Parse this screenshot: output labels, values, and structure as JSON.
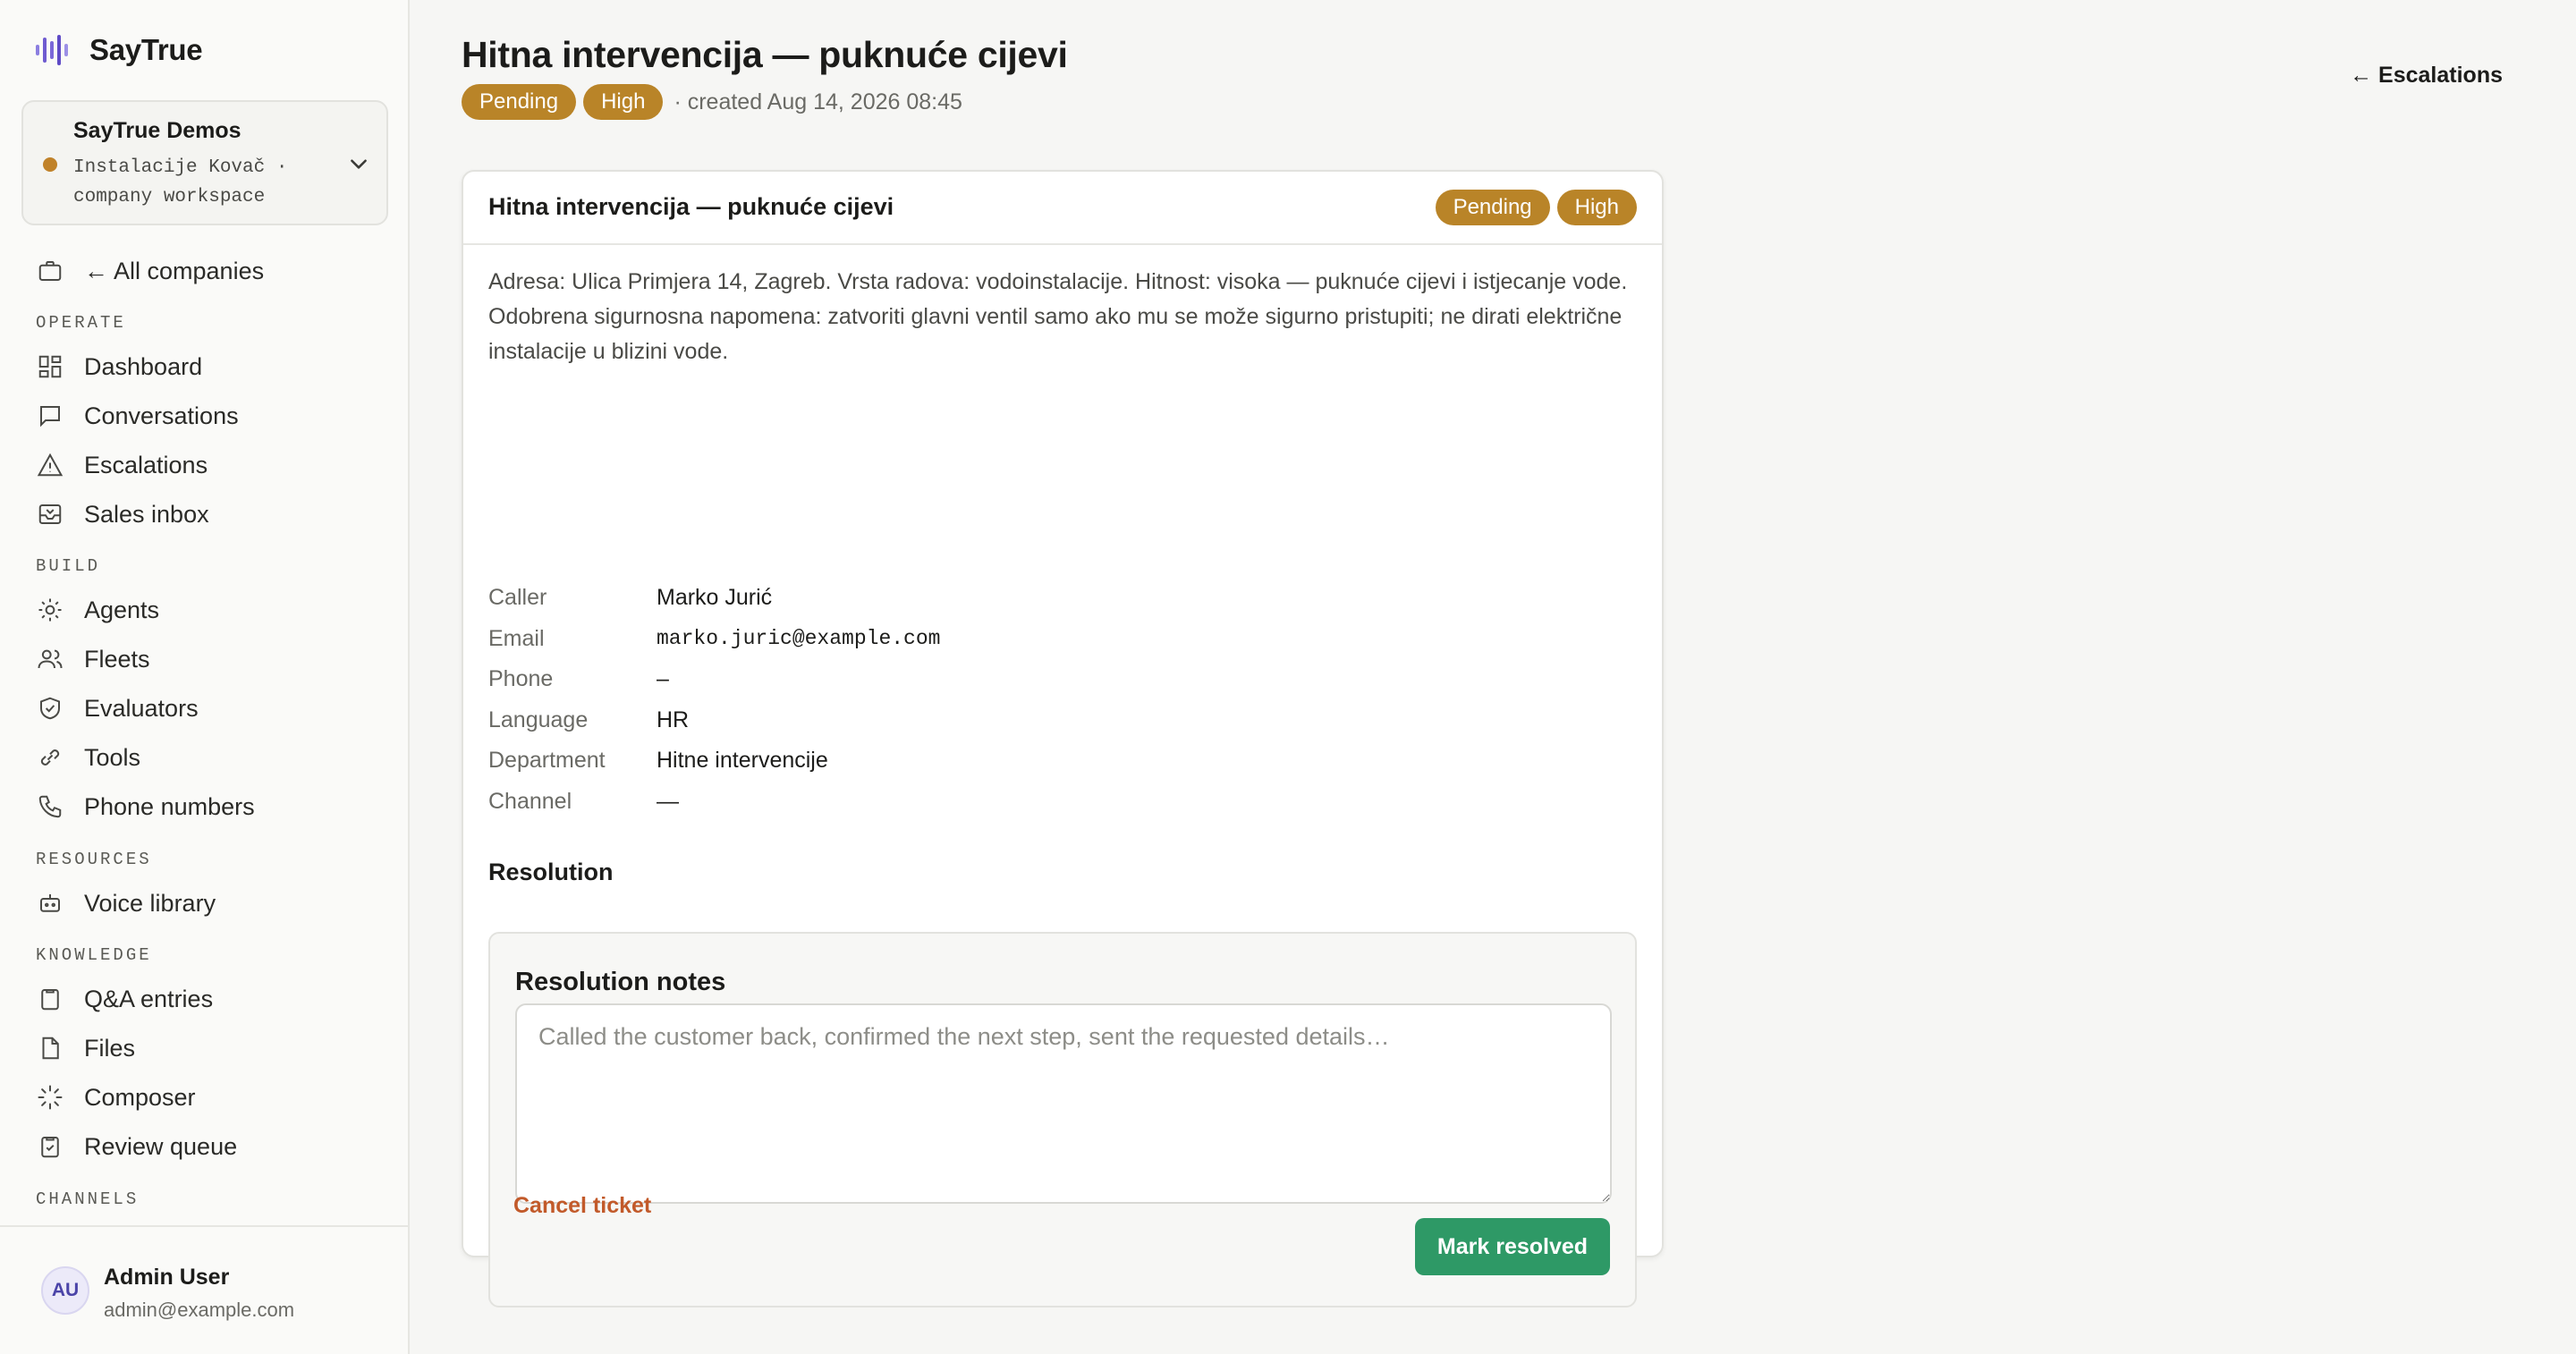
{
  "brand": {
    "name": "SayTrue"
  },
  "workspace": {
    "name": "SayTrue Demos",
    "subtitle": "Instalacije Kovač · company workspace",
    "dot_color": "#c0822a"
  },
  "sidebar": {
    "all_companies": "← All companies",
    "sections": {
      "operate": "OPERATE",
      "build": "BUILD",
      "resources": "RESOURCES",
      "knowledge": "KNOWLEDGE",
      "channels": "CHANNELS"
    },
    "items": {
      "dashboard": "Dashboard",
      "conversations": "Conversations",
      "escalations": "Escalations",
      "sales_inbox": "Sales inbox",
      "agents": "Agents",
      "fleets": "Fleets",
      "evaluators": "Evaluators",
      "tools": "Tools",
      "phone_numbers": "Phone numbers",
      "voice_library": "Voice library",
      "qa_entries": "Q&A entries",
      "files": "Files",
      "composer": "Composer",
      "review_queue": "Review queue"
    }
  },
  "user": {
    "initials": "AU",
    "name": "Admin User",
    "email": "admin@example.com"
  },
  "header": {
    "title": "Hitna intervencija — puknuće cijevi",
    "status": "Pending",
    "priority": "High",
    "created": "· created Aug 14, 2026 08:45",
    "back_link": "← Escalations"
  },
  "ticket": {
    "title": "Hitna intervencija — puknuće cijevi",
    "status": "Pending",
    "priority": "High",
    "description": "Adresa: Ulica Primjera 14, Zagreb. Vrsta radova: vodoinstalacije. Hitnost: visoka — puknuće cijevi i istjecanje vode. Odobrena sigurnosna napomena: zatvoriti glavni ventil samo ako mu se može sigurno pristupiti; ne dirati električne instalacije u blizini vode.",
    "fields": {
      "caller_label": "Caller",
      "caller": "Marko Jurić",
      "email_label": "Email",
      "email": "marko.juric@example.com",
      "phone_label": "Phone",
      "phone": "–",
      "language_label": "Language",
      "language": "HR",
      "department_label": "Department",
      "department": "Hitne intervencije",
      "channel_label": "Channel",
      "channel": "—"
    }
  },
  "resolution": {
    "heading": "Resolution",
    "notes_label": "Resolution notes",
    "notes_value": "",
    "notes_placeholder": "Called the customer back, confirmed the next step, sent the requested details…",
    "resolve_button": "Mark resolved",
    "cancel_link": "Cancel ticket"
  },
  "colors": {
    "pill": "#b98428",
    "resolve": "#2e9966",
    "cancel": "#c25a2a",
    "logo": "#6f5bd0"
  }
}
